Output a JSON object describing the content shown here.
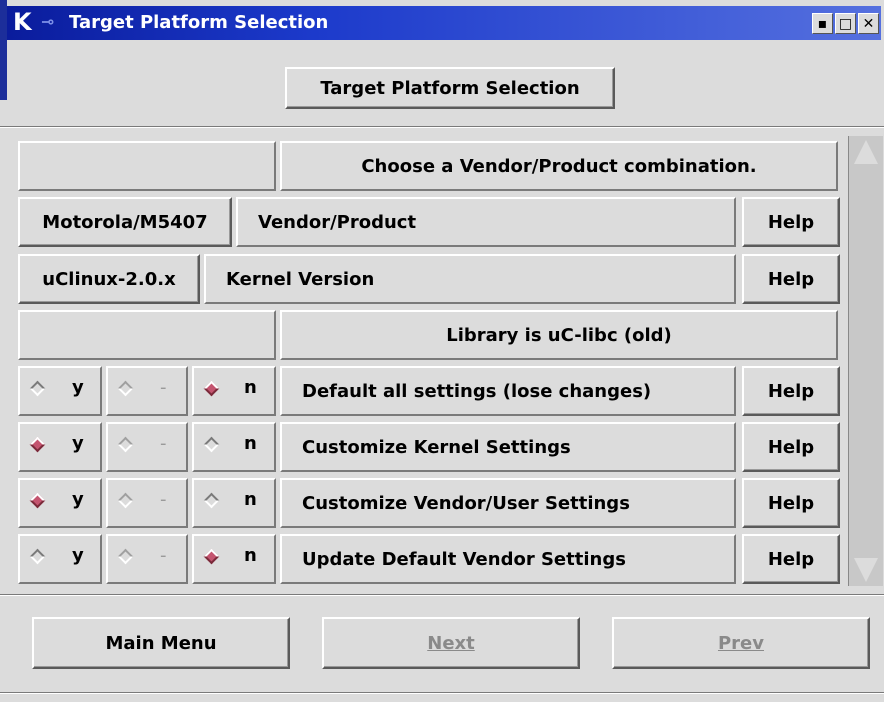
{
  "window": {
    "title": "Target Platform Selection",
    "header_button": "Target Platform Selection",
    "controls": [
      "▪",
      "□",
      "✕"
    ]
  },
  "rows": {
    "choose": "Choose a Vendor/Product combination.",
    "vendor": {
      "value": "Motorola/M5407",
      "label": "Vendor/Product",
      "help": "Help"
    },
    "kernel": {
      "value": "uClinux-2.0.x",
      "label": "Kernel Version",
      "help": "Help"
    },
    "library": "Library is uC-libc (old)"
  },
  "options": [
    {
      "label": "Default all settings (lose changes)",
      "selected": "n",
      "help": "Help",
      "y": "y",
      "m": "-",
      "n": "n"
    },
    {
      "label": "Customize Kernel Settings",
      "selected": "y",
      "help": "Help",
      "y": "y",
      "m": "-",
      "n": "n"
    },
    {
      "label": "Customize Vendor/User Settings",
      "selected": "y",
      "help": "Help",
      "y": "y",
      "m": "-",
      "n": "n"
    },
    {
      "label": "Update Default Vendor Settings",
      "selected": "n",
      "help": "Help",
      "y": "y",
      "m": "-",
      "n": "n"
    }
  ],
  "footer": {
    "main_menu": "Main Menu",
    "next": "Next",
    "prev": "Prev"
  },
  "colors": {
    "titlebar": "#1c3acb",
    "radio_selected": "#c4546f",
    "face": "#dcdcdc"
  }
}
